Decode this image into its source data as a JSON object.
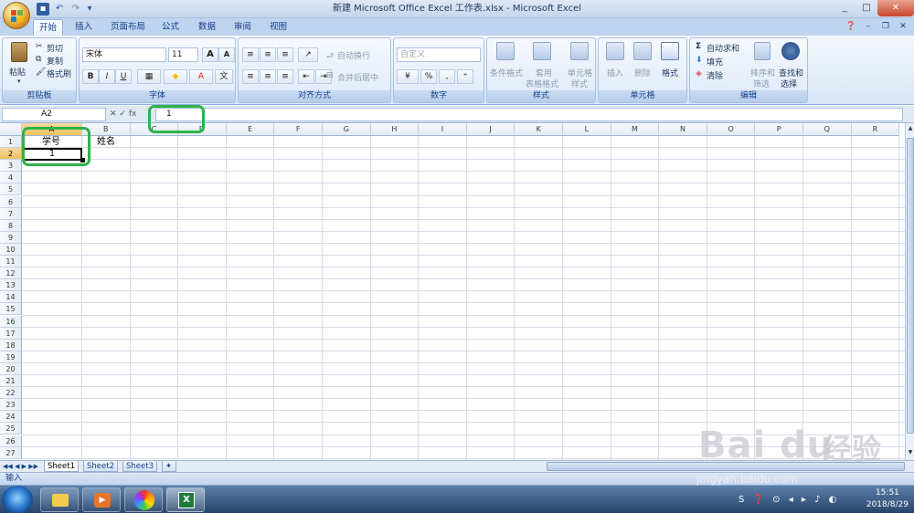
{
  "window": {
    "title": "新建 Microsoft Office Excel 工作表.xlsx - Microsoft Excel",
    "controls": [
      "_",
      "□",
      "✕"
    ]
  },
  "tabs": [
    "开始",
    "插入",
    "页面布局",
    "公式",
    "数据",
    "审阅",
    "视图"
  ],
  "active_tab": "开始",
  "ribbon": {
    "clipboard": {
      "label": "剪贴板",
      "paste": "粘贴",
      "cut": "剪切",
      "copy": "复制",
      "format_painter": "格式刷"
    },
    "font": {
      "label": "字体",
      "font_name": "宋体",
      "font_size": "11",
      "bold": "B",
      "italic": "I",
      "underline": "U",
      "grow": "A",
      "shrink": "A"
    },
    "alignment": {
      "label": "对齐方式",
      "wrap": "自动换行",
      "merge": "合并后居中"
    },
    "number": {
      "label": "数字",
      "format": "自定义",
      "percent": "%",
      "comma": ","
    },
    "styles": {
      "label": "样式",
      "conditional": "条件格式",
      "table": "套用",
      "table2": "表格格式",
      "cell": "单元格",
      "cell2": "样式"
    },
    "cells": {
      "label": "单元格",
      "insert": "插入",
      "delete": "删除",
      "format": "格式"
    },
    "editing": {
      "label": "编辑",
      "autosum": "自动求和",
      "fill": "填充",
      "clear": "清除",
      "sort": "排序和",
      "sort2": "筛选",
      "find": "查找和",
      "find2": "选择"
    }
  },
  "formula_bar": {
    "name_box": "A2",
    "value": "1"
  },
  "columns": [
    "A",
    "B",
    "C",
    "D",
    "E",
    "F",
    "G",
    "H",
    "I",
    "J",
    "K",
    "L",
    "M",
    "N",
    "O",
    "P",
    "Q",
    "R"
  ],
  "rows": [
    "1",
    "2",
    "3",
    "4",
    "5",
    "6",
    "7",
    "8",
    "9",
    "10",
    "11",
    "12",
    "13",
    "14",
    "15",
    "16",
    "17",
    "18",
    "19",
    "20",
    "21",
    "22",
    "23",
    "24",
    "25",
    "26",
    "27"
  ],
  "cells": {
    "A1": "学号",
    "B1": "姓名",
    "A2": "1"
  },
  "sheets": [
    "Sheet1",
    "Sheet2",
    "Sheet3"
  ],
  "active_sheet": "Sheet1",
  "status": {
    "mode": "输入"
  },
  "taskbar": {
    "time": "15:51",
    "date": "2018/8/29"
  },
  "watermark": {
    "brand": "Bai du",
    "cn": "经验",
    "url": "jingyan.baidu.com"
  },
  "colors": {
    "highlight": "#2fb34a",
    "accent": "#15428b"
  }
}
